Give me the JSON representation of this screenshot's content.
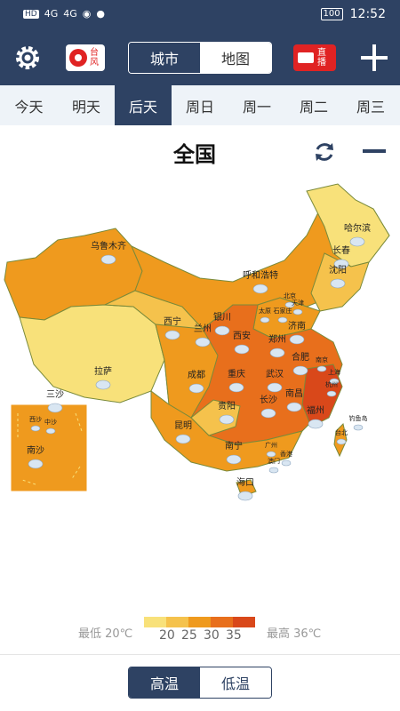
{
  "status_bar": {
    "left_icons": [
      "HD",
      "4G",
      "4G",
      "wifi-icon",
      "message-icon"
    ],
    "battery": "100",
    "time": "12:52"
  },
  "top_bar": {
    "typhoon_label": "台风",
    "segment": {
      "city": "城市",
      "map": "地图",
      "active": "map"
    },
    "live_label": "直播"
  },
  "day_tabs": [
    "今天",
    "明天",
    "后天",
    "周日",
    "周一",
    "周二",
    "周三"
  ],
  "active_day": "后天",
  "region_title": "全国",
  "map": {
    "cities": [
      "乌鲁木齐",
      "呼和浩特",
      "哈尔滨",
      "长春",
      "沈阳",
      "北京",
      "天津",
      "太原",
      "石家庄",
      "济南",
      "银川",
      "西宁",
      "兰州",
      "西安",
      "郑州",
      "南京",
      "合肥",
      "上海",
      "拉萨",
      "成都",
      "重庆",
      "武汉",
      "杭州",
      "南昌",
      "长沙",
      "贵阳",
      "福州",
      "台北",
      "昆明",
      "南宁",
      "广州",
      "香港",
      "澳门",
      "海口",
      "钓鱼岛",
      "三沙",
      "西沙",
      "中沙",
      "南沙"
    ]
  },
  "legend": {
    "low_label": "最低 20℃",
    "high_label": "最高 36℃",
    "ticks": [
      "20",
      "25",
      "30",
      "35"
    ],
    "colors": [
      "#f8e17a",
      "#f5c24c",
      "#ef9a1e",
      "#e86f1c",
      "#d9481a"
    ]
  },
  "bottom_toggle": {
    "high": "高温",
    "low": "低温",
    "active": "high"
  }
}
